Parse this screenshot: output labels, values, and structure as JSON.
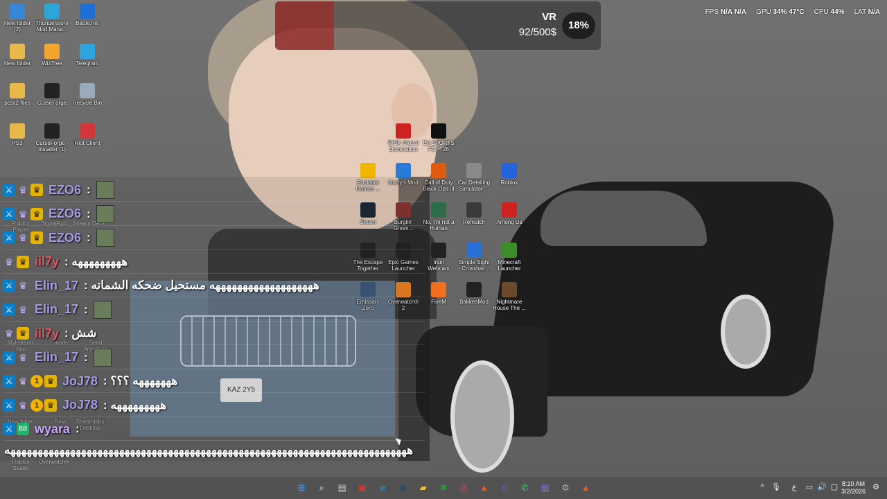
{
  "overlay": {
    "vr_label": "VR",
    "vr_amount": "92/500$",
    "vr_percent": "18%",
    "fps_label": "FPS",
    "fps_value1": "N/A",
    "fps_value2": "N/A",
    "gpu_label": "GPU",
    "gpu_value": "34% 47°C",
    "cpu_label": "CPU",
    "cpu_value": "44%",
    "lat_label": "LAT",
    "lat_value": "N/A"
  },
  "desktop_icons": [
    {
      "label": "New folder (2)",
      "color": "#3a86d6"
    },
    {
      "label": "Thunderstore Mod Mana...",
      "color": "#2aa6d8"
    },
    {
      "label": "Battle.net",
      "color": "#1e6fd6"
    },
    {
      "label": "New folder",
      "color": "#e8b84a"
    },
    {
      "label": "WizTree",
      "color": "#f2a52f"
    },
    {
      "label": "Telegram",
      "color": "#2ea4e0"
    },
    {
      "label": "pcsx2-files",
      "color": "#e8b84a"
    },
    {
      "label": "CurseForge",
      "color": "#222222"
    },
    {
      "label": "Recycle Bin",
      "color": "#9ab"
    },
    {
      "label": "PS3",
      "color": "#e8b84a"
    },
    {
      "label": "CurseForge - Installer (1)",
      "color": "#222222"
    },
    {
      "label": "Riot Client",
      "color": "#d13639"
    },
    {
      "label": "RISK Global Domination",
      "color": "#c22"
    },
    {
      "label": "EA SPORTS FC™ 26",
      "color": "#111"
    },
    {
      "label": "Rockstar Games ...",
      "color": "#f2b600"
    },
    {
      "label": "Garry's Mod",
      "color": "#2a7bd8"
    },
    {
      "label": "Call of Duty Black Ops III",
      "color": "#e05a10"
    },
    {
      "label": "Car Detailing Simulator ...",
      "color": "#8a8a8a"
    },
    {
      "label": "Roblox",
      "color": "#2463dc"
    },
    {
      "label": "Steam",
      "color": "#1b2838"
    },
    {
      "label": "Burglin' Gnom...",
      "color": "#8a3232"
    },
    {
      "label": "No, I'm not a Human",
      "color": "#2c6c48"
    },
    {
      "label": "Rematch",
      "color": "#3a3a3a"
    },
    {
      "label": "Among Us",
      "color": "#c22"
    },
    {
      "label": "The Escape Together",
      "color": "#222"
    },
    {
      "label": "Epic Games Launcher",
      "color": "#222"
    },
    {
      "label": "Iriun Webcam",
      "color": "#222"
    },
    {
      "label": "Simple Sight - Crosshair...",
      "color": "#2a6fd6"
    },
    {
      "label": "Minecraft Launcher",
      "color": "#3c8c2c"
    },
    {
      "label": "Emissary Zero",
      "color": "#3a5a7a"
    },
    {
      "label": "Overwatch® 2",
      "color": "#f08020"
    },
    {
      "label": "FiveM",
      "color": "#f07020"
    },
    {
      "label": "BakkesMod",
      "color": "#222"
    },
    {
      "label": "Nightmare House The ...",
      "color": "#6a4a2a"
    }
  ],
  "chat": {
    "messages": [
      {
        "user": "EZO6",
        "text": ":",
        "color": "#a99ae8"
      },
      {
        "user": "EZO6",
        "text": ":",
        "color": "#a99ae8"
      },
      {
        "user": "EZO6",
        "text": ":",
        "color": "#a99ae8"
      },
      {
        "user": "iil7y",
        "text": ": هههههههههه",
        "color": "#e05a6a"
      },
      {
        "user": "Elin_17",
        "text": ": هههههههههههههههههههه مستحيل ضحكه الشماته",
        "color": "#a99ae8"
      },
      {
        "user": "Elin_17",
        "text": ":",
        "color": "#a99ae8"
      },
      {
        "user": "iil7y",
        "text": ": شش",
        "color": "#e05a6a"
      },
      {
        "user": "Elin_17",
        "text": ":",
        "color": "#a99ae8"
      },
      {
        "user": "JoJ78",
        "text": ": هههههههه ؟؟؟",
        "color": "#a99ae8"
      },
      {
        "user": "JoJ78",
        "text": ": هههههههههه",
        "color": "#a99ae8"
      },
      {
        "user": "wyara",
        "text": ":",
        "color": "#c9a6ff"
      }
    ],
    "long_message": "ههههههههههههههههههههههههههههههههههههههههههههههههههههههههههههههههههههههههههه",
    "badges": {
      "mod": "⚔",
      "sub": "♛",
      "crown": "♛",
      "num": "1",
      "green": "88"
    }
  },
  "desktop_overlapped_labels": [
    "Roblox Player",
    "SignalRgb",
    "Stream Deck",
    "Roblox Studio",
    "Overwatch®",
    "Streamlabs Desktop",
    "Myinstants App",
    "mods",
    "Send Anywhere",
    "New folder",
    "Revo"
  ],
  "taskbar": {
    "apps": [
      "windows-start",
      "search",
      "file-manager",
      "app-red",
      "edge",
      "steam",
      "explorer",
      "xbox",
      "chrome",
      "brave",
      "discord",
      "whatsapp",
      "app-grid",
      "settings",
      "brave-beta"
    ],
    "tray_chevron": "^",
    "tray_lang": "ع",
    "time": "8:10 AM",
    "date": "3/2/2026"
  }
}
